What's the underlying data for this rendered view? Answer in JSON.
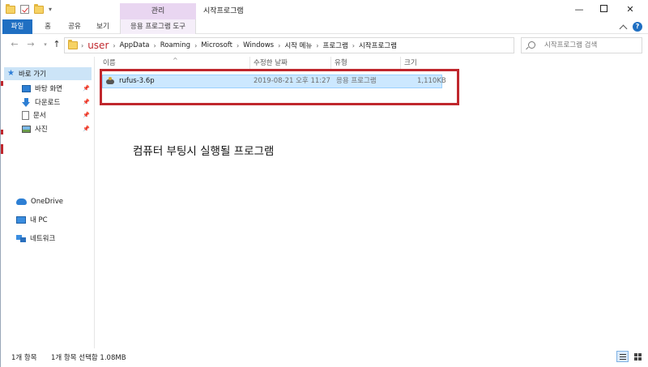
{
  "window": {
    "title": "시작프로그램",
    "context_group": "관리",
    "minimize": "—",
    "close": "✕"
  },
  "ribbon": {
    "tabs": [
      "파일",
      "홈",
      "공유",
      "보기",
      "응용 프로그램 도구"
    ],
    "help": "?"
  },
  "address": {
    "crumbs": [
      "user",
      "AppData",
      "Roaming",
      "Microsoft",
      "Windows",
      "시작 메뉴",
      "프로그램",
      "시작프로그램"
    ],
    "separator": "›",
    "search_placeholder": "시작프로그램 검색"
  },
  "nav": {
    "quick_access": "바로 가기",
    "items": [
      "바탕 화면",
      "다운로드",
      "문서",
      "사진"
    ],
    "onedrive": "OneDrive",
    "this_pc": "내 PC",
    "network": "네트워크"
  },
  "columns": {
    "name": "이름",
    "date": "수정한 날짜",
    "type": "유형",
    "size": "크기"
  },
  "files": [
    {
      "name": "rufus-3.6p",
      "date": "2019-08-21 오후 11:27",
      "type": "응용 프로그램",
      "size": "1,110KB"
    }
  ],
  "annotation": "컴퓨터 부팅시 실행될 프로그램",
  "status": {
    "count": "1개 항목",
    "selection": "1개 항목 선택함 1.08MB"
  },
  "colors": {
    "accent": "#1f6fc2",
    "highlight_box": "#c0272d",
    "selection": "#cce8ff",
    "manage_tab": "#e9d6f1"
  }
}
